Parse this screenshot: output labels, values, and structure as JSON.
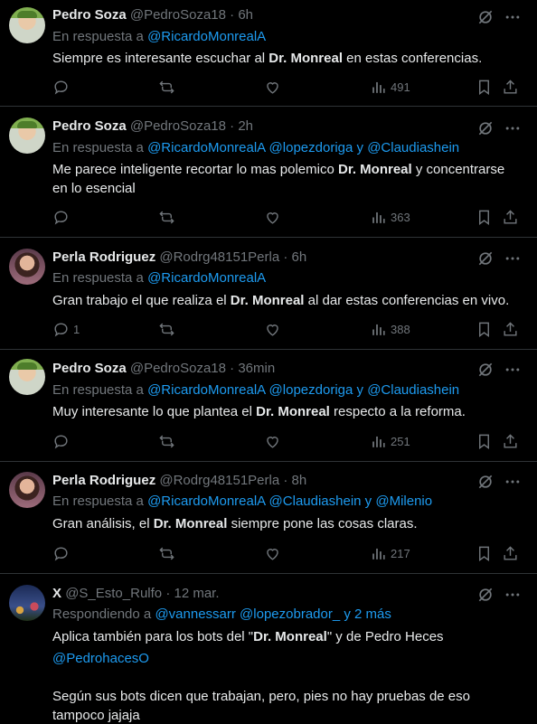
{
  "tweets": [
    {
      "name": "Pedro Soza",
      "handle": "@PedroSoza18",
      "time": "6h",
      "reply_prefix": "En respuesta a",
      "mentions": [
        "@RicardoMonrealA"
      ],
      "reply_suffix": [],
      "text_parts": [
        "Siempre es interesante escuchar al ",
        "Dr. Monreal",
        " en estas conferencias."
      ],
      "replies": "",
      "views": "491"
    },
    {
      "name": "Pedro Soza",
      "handle": "@PedroSoza18",
      "time": "2h",
      "reply_prefix": "En respuesta a",
      "mentions": [
        "@RicardoMonrealA",
        "@lopezdoriga",
        "@Claudiashein"
      ],
      "joiner": "y",
      "text_parts": [
        "Me parece inteligente recortar lo mas polemico ",
        "Dr. Monreal",
        " y concentrarse en lo esencial"
      ],
      "replies": "",
      "views": "363"
    },
    {
      "name": "Perla Rodriguez",
      "handle": "@Rodrg48151Perla",
      "time": "6h",
      "reply_prefix": "En respuesta a",
      "mentions": [
        "@RicardoMonrealA"
      ],
      "text_parts": [
        "Gran trabajo el que realiza el ",
        "Dr. Monreal",
        " al dar estas conferencias en vivo."
      ],
      "replies": "1",
      "views": "388"
    },
    {
      "name": "Pedro Soza",
      "handle": "@PedroSoza18",
      "time": "36min",
      "reply_prefix": "En respuesta a",
      "mentions": [
        "@RicardoMonrealA",
        "@lopezdoriga",
        "@Claudiashein"
      ],
      "joiner": "y",
      "text_parts": [
        "Muy interesante lo que plantea el ",
        "Dr. Monreal",
        " respecto a la reforma."
      ],
      "replies": "",
      "views": "251"
    },
    {
      "name": "Perla Rodriguez",
      "handle": "@Rodrg48151Perla",
      "time": "8h",
      "reply_prefix": "En respuesta a",
      "mentions": [
        "@RicardoMonrealA",
        "@Claudiashein",
        "@Milenio"
      ],
      "joiner": "y",
      "text_parts": [
        "Gran análisis, el ",
        "Dr. Monreal",
        " siempre pone las cosas claras."
      ],
      "replies": "",
      "views": "217"
    },
    {
      "name": "X",
      "handle": "@S_Esto_Rulfo",
      "time": "12 mar.",
      "reply_prefix": "Respondiendo a",
      "mentions": [
        "@vannessarr",
        "@lopezobrador_"
      ],
      "reply_more": "y 2 más",
      "text_parts": [
        "Aplica también para los bots del \"",
        "Dr. Monreal",
        "\" y de Pedro Heces"
      ],
      "text_link": "@PedrohacesO",
      "text_extra": "Según sus bots dicen que trabajan, pero, pies no hay pruebas de eso tampoco jajaja"
    }
  ]
}
